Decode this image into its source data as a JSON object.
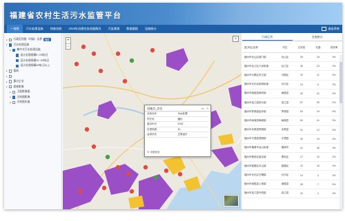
{
  "app": {
    "title": "福建省农村生活污水监管平台",
    "exit_label": "退出系统"
  },
  "nav": {
    "items": [
      "一张图",
      "污水处理设施",
      "排查台账",
      "2019年治理任务进展情况",
      "污染溯源",
      "数据填报",
      "设施统计"
    ]
  },
  "layers": [
    {
      "label": "行政区划图（村级）边界",
      "checked": false,
      "indent": 0,
      "badge": "图层"
    },
    {
      "label": "污水处理设施",
      "checked": true,
      "indent": 0
    },
    {
      "label": "集中式污水处理设施",
      "checked": true,
      "indent": 1
    },
    {
      "label": "设计处理规模5~20吨/日",
      "checked": true,
      "indent": 2
    },
    {
      "label": "设计处理规模20~50吨/日",
      "checked": true,
      "indent": 2
    },
    {
      "label": "设计处理规模50吨/日以上",
      "checked": true,
      "indent": 2
    },
    {
      "label": "管网",
      "checked": false,
      "indent": 0
    },
    {
      "label": "",
      "checked": false,
      "indent": 0
    },
    {
      "label": "重点企业",
      "checked": false,
      "indent": 0
    },
    {
      "label": "遥感影像",
      "checked": false,
      "indent": 0
    },
    {
      "label": "卫星影像图",
      "checked": false,
      "indent": 1
    },
    {
      "label": "天地图影像",
      "checked": true,
      "indent": 1
    },
    {
      "label": "天地图矢量",
      "checked": false,
      "indent": 1
    }
  ],
  "map": {
    "zoom_in": "+",
    "zoom_out": "−",
    "close": "×"
  },
  "popup": {
    "title": "设施点_点位",
    "rows": [
      {
        "k": "设施名称",
        "v": "污水处理"
      },
      {
        "k": "所在地",
        "v": "福州"
      },
      {
        "k": "建设年份",
        "v": "2018"
      },
      {
        "k": "处理规模",
        "v": "20"
      },
      {
        "k": "运维状态",
        "v": "正常运行"
      }
    ],
    "footer": "详细信息"
  },
  "panel": {
    "tabs": [
      "行政区划",
      "设施统计"
    ],
    "headers": [
      "县(市区)名称",
      "村庄",
      "已完成",
      "在建",
      "完成率"
    ],
    "rows": [
      {
        "name": "福州市仓山区城门镇",
        "village": "仓山区",
        "a": "25",
        "b": "18",
        "pct": "3%"
      },
      {
        "name": "福州市台江区义洲街道",
        "village": "台江区",
        "a": "26",
        "b": "23",
        "pct": "2%"
      },
      {
        "name": "福州市马尾区亭江镇",
        "village": "马尾区",
        "a": "33",
        "b": "11",
        "pct": "3%"
      },
      {
        "name": "福州市长乐区航城街道",
        "village": "长乐区",
        "a": "13",
        "b": "6",
        "pct": "2%"
      },
      {
        "name": "福州市闽侯县南屿镇",
        "village": "闽侯县",
        "a": "43",
        "b": "31",
        "pct": "3%"
      },
      {
        "name": "福州市连江县琯头镇",
        "village": "连江县",
        "a": "57",
        "b": "39",
        "pct": "2%"
      },
      {
        "name": "福州市罗源县起步镇",
        "village": "罗源县",
        "a": "53",
        "b": "19",
        "pct": "5%"
      },
      {
        "name": "福州市闽清县梅城镇",
        "village": "闽清县",
        "a": "80",
        "b": "61",
        "pct": "3%"
      },
      {
        "name": "福州市永泰县樟城镇",
        "village": "永泰县",
        "a": "31",
        "b": "12",
        "pct": "2%"
      },
      {
        "name": "福州市平潭县潭城镇",
        "village": "平潭县",
        "a": "30",
        "b": "19",
        "pct": "3%"
      },
      {
        "name": "福州市福清市龙山街道",
        "village": "福清市",
        "a": "41",
        "b": "36",
        "pct": "3%"
      },
      {
        "name": "福州市晋安区新店镇",
        "village": "晋安区",
        "a": "17",
        "b": "10",
        "pct": "2%"
      },
      {
        "name": "福州市鼓楼区洪山镇",
        "village": "鼓楼区",
        "a": "23",
        "b": "16",
        "pct": "3%"
      },
      {
        "name": "福州市长乐区古槐镇",
        "village": "长乐区",
        "a": "14",
        "b": "4",
        "pct": "3%"
      },
      {
        "name": "福州市闽侯县上街镇",
        "village": "闽侯县",
        "a": "28",
        "b": "7",
        "pct": "5%"
      },
      {
        "name": "福州市连江县丹阳镇",
        "village": "连江县",
        "a": "20",
        "b": "2",
        "pct": "3%"
      }
    ]
  },
  "colors": {
    "header": "#2f6fb6",
    "nav": "#1e5fa8",
    "purple_area": "#9b4fc6",
    "yellow_area": "#f2c230",
    "marker_red": "#e34a3f",
    "marker_green": "#43a047"
  }
}
